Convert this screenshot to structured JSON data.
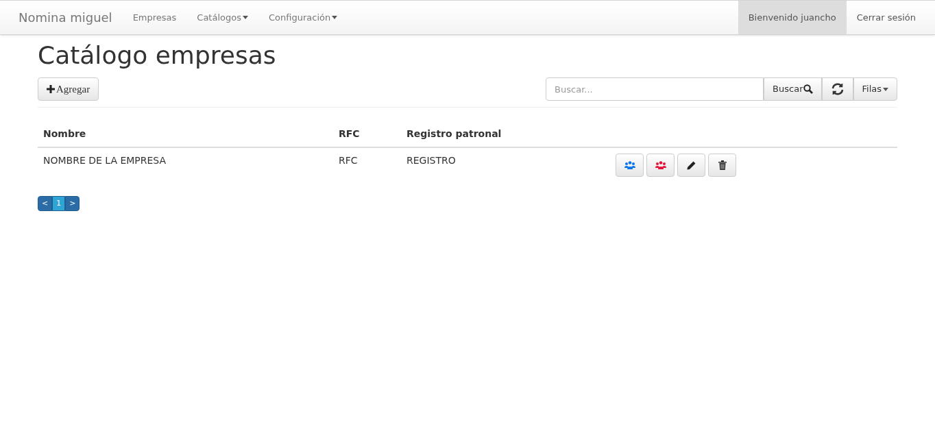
{
  "navbar": {
    "brand": "Nomina miguel",
    "items": [
      {
        "label": "Empresas",
        "dropdown": false
      },
      {
        "label": "Catálogos",
        "dropdown": true
      },
      {
        "label": "Configuración",
        "dropdown": true
      }
    ],
    "right_items": [
      {
        "label": "Bienvenido juancho",
        "selected": true
      },
      {
        "label": "Cerrar sesión",
        "selected": false
      }
    ]
  },
  "title": "Catálogo empresas",
  "toolbar": {
    "add_button": "Agregar",
    "search": {
      "placeholder": "Buscar..."
    },
    "search_button": "Buscar",
    "rows_button": "Filas"
  },
  "table": {
    "columns": [
      "Nombre",
      "RFC",
      "Registro patronal"
    ],
    "rows": [
      {
        "cells": [
          "NOMBRE DE LA EMPRESA",
          "RFC",
          "REGISTRO"
        ],
        "actions": [
          {
            "kind": "group",
            "color": "#0a74e8"
          },
          {
            "kind": "group",
            "color": "#e3133c"
          },
          {
            "kind": "edit"
          },
          {
            "kind": "delete"
          }
        ]
      }
    ]
  },
  "pagination": [
    {
      "label": "<",
      "selected": false
    },
    {
      "label": "1",
      "selected": true
    },
    {
      "label": ">",
      "selected": false
    }
  ]
}
